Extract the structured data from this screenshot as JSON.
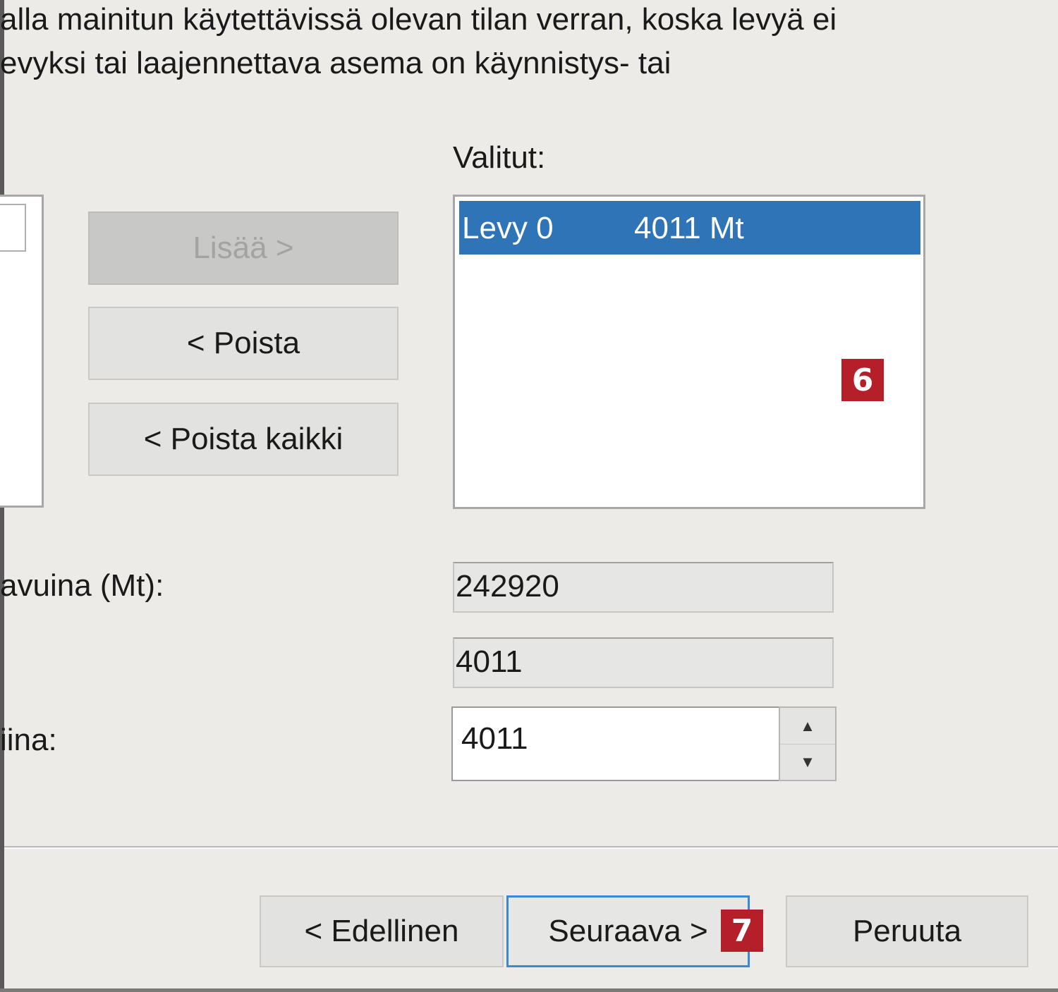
{
  "intro": {
    "line1": "alla mainitun käytettävissä olevan tilan verran, koska levyä ei",
    "line2": "evyksi tai laajennettava asema on käynnistys- tai"
  },
  "buttons": {
    "add": "Lisää >",
    "remove": "< Poista",
    "remove_all": "< Poista kaikki"
  },
  "selected": {
    "label": "Valitut:",
    "items": [
      {
        "disk": "Levy 0",
        "size": "4011 Mt"
      }
    ]
  },
  "fields": {
    "total_label": "avuina (Mt):",
    "total_value": "242920",
    "max_value": "4011",
    "amount_label": "iina:",
    "amount_value": "4011"
  },
  "footer": {
    "back": "< Edellinen",
    "next": "Seuraava >",
    "cancel": "Peruuta"
  },
  "badges": {
    "step6": "6",
    "step7": "7"
  },
  "icons": {
    "spin_up": "chevron-up-icon",
    "spin_down": "chevron-down-icon"
  },
  "colors": {
    "selection": "#2e74b6",
    "badge": "#b41f2a",
    "focus_border": "#3a8ad0"
  }
}
